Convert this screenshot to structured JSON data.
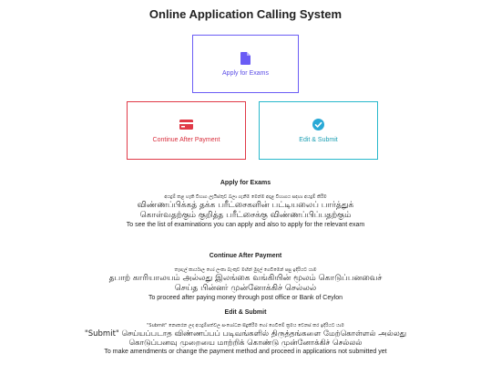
{
  "page": {
    "title": "Online Application Calling System"
  },
  "cards": {
    "apply": {
      "label": "Apply for Exams",
      "icon": "document-icon",
      "color": "#5b4de6"
    },
    "payment": {
      "label": "Continue After Payment",
      "icon": "credit-card-icon",
      "color": "#d9303e"
    },
    "edit": {
      "label": "Edit & Submit",
      "icon": "check-circle-icon",
      "color": "#1c9fb3"
    }
  },
  "sections": {
    "apply": {
      "heading": "Apply for Exams",
      "sinhala": "අයදුම් කළ හැකි විභාග ලැයිස්තුව බලා ගැනීම මෙන්ම අදාළ විභාගය සඳහා අයදුම් කිරීම",
      "tamil": "விண்ணப்பிக்கத் தக்க பரீட்சைகளின் பட்டியலைப் பார்த்துக் கொள்வதற்கும் குறித்த பரீட்சைக்கு விண்ணப்பிப்பதற்கும்",
      "english": "To see the list of examinations you can apply and also to apply for the relevant exam"
    },
    "payment": {
      "heading": "Continue After Payment",
      "sinhala": "තැපැල් කාර්යාල හෝ ලංකා බැංකුව මඟින් මුදල් ගෙවීමෙන් පසු ඉදිරියට යාම",
      "tamil": "தபாற் காரியாலயம் அல்லது இலங்கை வங்கியின் மூலம் கொடுப்பனவைச் செய்த பின்னர் முன்னோக்கிச் செல்லல்",
      "english": "To proceed after paying money through post office or Bank of Ceylon"
    },
    "edit": {
      "heading": "Edit & Submit",
      "sinhala": "\"Submit\" නොකරන ලද අයදුම්පත්වල සංශෝධන සිදුකිරීම හෝ ගෙවීමේ ක්‍රමය වෙනස් කර ඉදිරියට යාම",
      "tamil": "\"Submit\" செய்யப்படாத விண்ணப்பப் படிவங்களில் திருத்தங்களை மேற்கொள்ளல் அல்லது கொடுப்பனவு முறையை மாற்றிக் கொண்டு முன்னோக்கிச் செல்லல்",
      "english": "To make amendments or change the payment method and proceed in applications not submitted yet"
    }
  }
}
